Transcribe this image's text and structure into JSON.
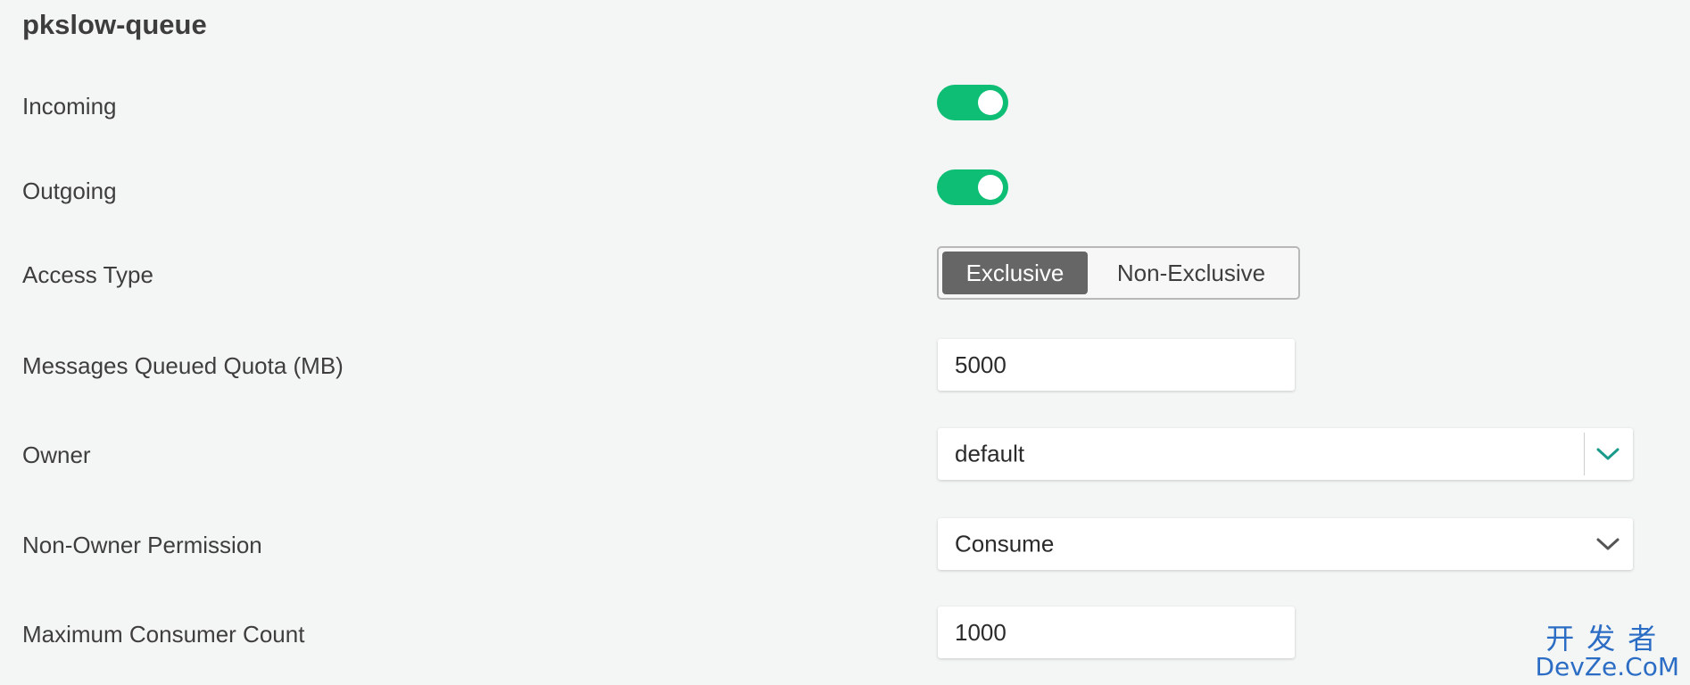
{
  "queue": {
    "name": "pkslow-queue"
  },
  "fields": {
    "incoming": {
      "label": "Incoming",
      "enabled": true
    },
    "outgoing": {
      "label": "Outgoing",
      "enabled": true
    },
    "access_type": {
      "label": "Access Type",
      "options": [
        "Exclusive",
        "Non-Exclusive"
      ],
      "selected": "Exclusive"
    },
    "quota": {
      "label": "Messages Queued Quota (MB)",
      "value": "5000"
    },
    "owner": {
      "label": "Owner",
      "value": "default"
    },
    "permission": {
      "label": "Non-Owner Permission",
      "value": "Consume"
    },
    "max_consumers": {
      "label": "Maximum Consumer Count",
      "value": "1000"
    }
  },
  "colors": {
    "toggle_on": "#0dbe74",
    "segment_active": "#666666",
    "owner_chevron": "#1a9a8a",
    "permission_chevron": "#555555",
    "watermark": "#2b6cc4"
  },
  "icons": {
    "owner_dropdown": "chevron-down-icon",
    "permission_dropdown": "chevron-down-icon"
  },
  "watermark": {
    "chinese": "开发者",
    "english": "DevZe.CoM"
  }
}
